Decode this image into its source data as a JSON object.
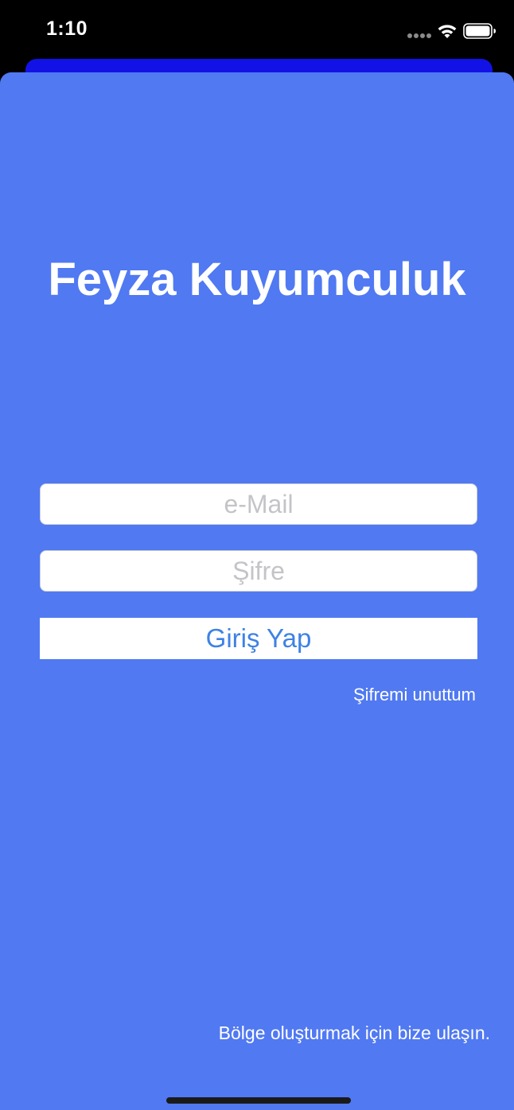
{
  "status_bar": {
    "time": "1:10",
    "icons": [
      "signal-dots-icon",
      "wifi-icon",
      "battery-icon"
    ]
  },
  "colors": {
    "background": "#5079f2",
    "back_sheet": "#1212e6",
    "button_text": "#3e82e4",
    "white": "#ffffff"
  },
  "login": {
    "title": "Feyza Kuyumculuk",
    "email_placeholder": "e-Mail",
    "email_value": "",
    "password_placeholder": "Şifre",
    "password_value": "",
    "login_button": "Giriş Yap",
    "forgot_password": "Şifremi unuttum",
    "contact_text": "Bölge oluşturmak için bize ulaşın."
  }
}
